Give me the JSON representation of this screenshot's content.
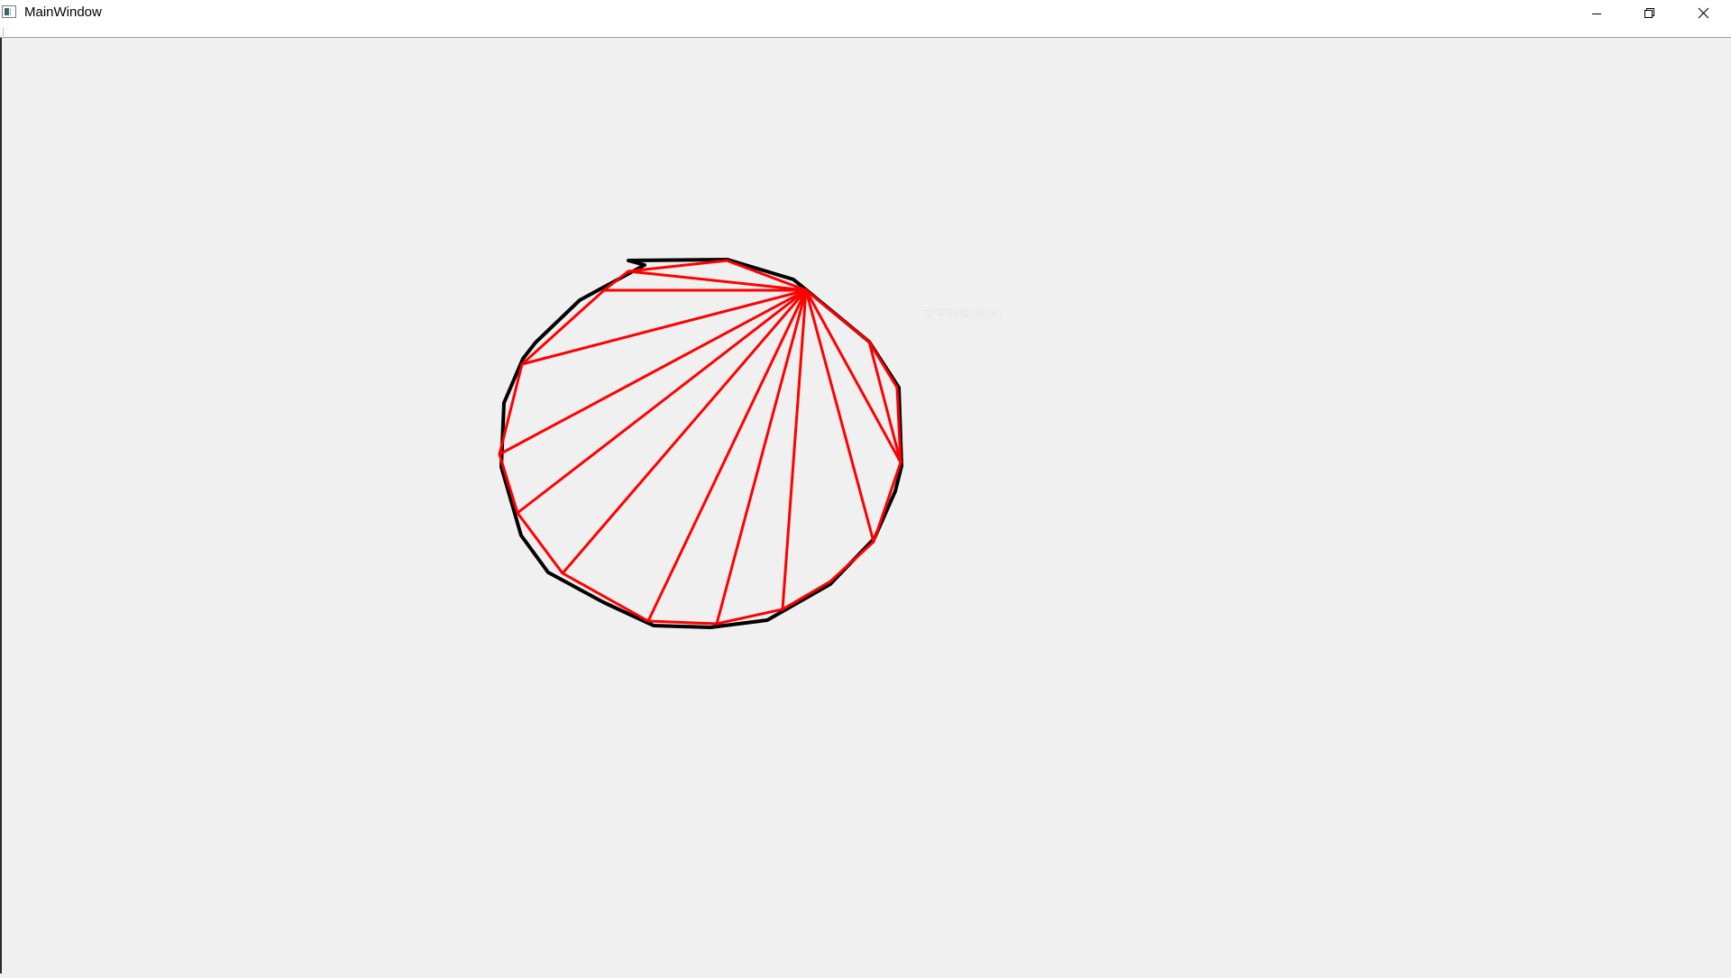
{
  "window": {
    "title": "MainWindow",
    "controls": {
      "minimize_icon": "minimize-icon",
      "maximize_icon": "restore-icon",
      "close_icon": "close-icon"
    }
  },
  "overlay": {
    "faint_label": "文字转换(提示)"
  },
  "drawing": {
    "polygon_color": "#000000",
    "triangulation_color": "#ff0000",
    "background": "#f0f0f0"
  }
}
